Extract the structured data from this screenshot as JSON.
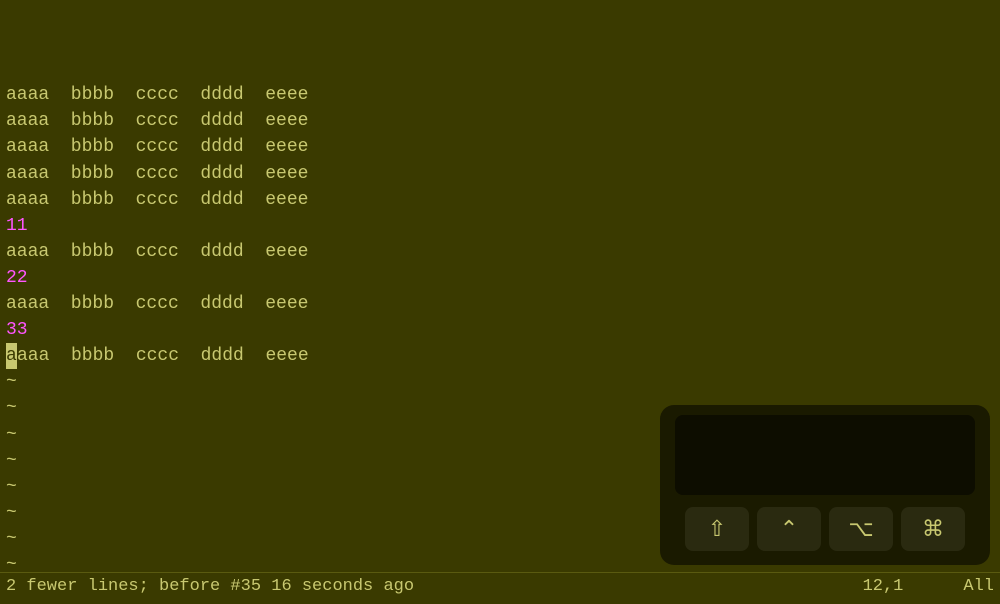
{
  "editor": {
    "lines": [
      {
        "type": "normal",
        "text": "aaaa  bbbb  cccc  dddd  eeee"
      },
      {
        "type": "normal",
        "text": "aaaa  bbbb  cccc  dddd  eeee"
      },
      {
        "type": "normal",
        "text": "aaaa  bbbb  cccc  dddd  eeee"
      },
      {
        "type": "normal",
        "text": "aaaa  bbbb  cccc  dddd  eeee"
      },
      {
        "type": "normal",
        "text": "aaaa  bbbb  cccc  dddd  eeee"
      },
      {
        "type": "number11",
        "text": "11"
      },
      {
        "type": "normal",
        "text": "aaaa  bbbb  cccc  dddd  eeee"
      },
      {
        "type": "number22",
        "text": "22"
      },
      {
        "type": "normal",
        "text": "aaaa  bbbb  cccc  dddd  eeee"
      },
      {
        "type": "number33",
        "text": "33"
      },
      {
        "type": "cursor_line",
        "text": "aaaa  bbbb  cccc  dddd  eeee"
      },
      {
        "type": "tilde",
        "text": "~"
      },
      {
        "type": "tilde",
        "text": "~"
      },
      {
        "type": "tilde",
        "text": "~"
      },
      {
        "type": "tilde",
        "text": "~"
      },
      {
        "type": "tilde",
        "text": "~"
      },
      {
        "type": "tilde",
        "text": "~"
      },
      {
        "type": "tilde",
        "text": "~"
      },
      {
        "type": "tilde",
        "text": "~"
      },
      {
        "type": "tilde",
        "text": "~"
      }
    ]
  },
  "status": {
    "left": "2 fewer lines; before #35  16 seconds ago",
    "position": "12,1",
    "mode": "All"
  },
  "osk": {
    "buttons": [
      {
        "icon": "⇧",
        "label": "shift"
      },
      {
        "icon": "⌃",
        "label": "ctrl"
      },
      {
        "icon": "⌥",
        "label": "alt"
      },
      {
        "icon": "⌘",
        "label": "cmd"
      }
    ]
  },
  "colors": {
    "bg": "#3a3a00",
    "text": "#c8c870",
    "magenta": "#ff55ff",
    "osk_bg": "#1a1a00",
    "osk_preview": "#0d0d00",
    "osk_btn": "#2a2a10"
  }
}
